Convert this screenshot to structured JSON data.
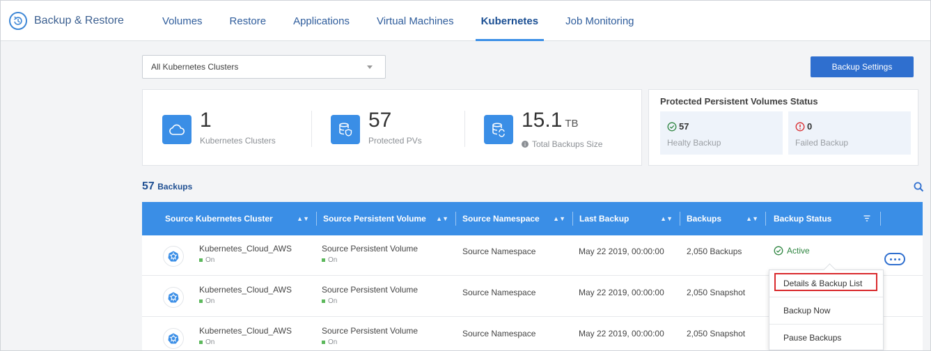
{
  "app": {
    "title": "Backup & Restore"
  },
  "nav": {
    "tabs": [
      {
        "label": "Volumes"
      },
      {
        "label": "Restore"
      },
      {
        "label": "Applications"
      },
      {
        "label": "Virtual Machines"
      },
      {
        "label": "Kubernetes",
        "active": true
      },
      {
        "label": "Job Monitoring"
      }
    ]
  },
  "filter": {
    "selected": "All Kubernetes Clusters"
  },
  "toolbar": {
    "backup_settings_label": "Backup Settings"
  },
  "stats": [
    {
      "value": "1",
      "unit": "",
      "label": "Kubernetes Clusters",
      "icon": "cloud-icon"
    },
    {
      "value": "57",
      "unit": "",
      "label": "Protected PVs",
      "icon": "database-shield-icon"
    },
    {
      "value": "15.1",
      "unit": "TB",
      "label": "Total Backups Size",
      "icon": "database-sync-icon"
    }
  ],
  "pv_status": {
    "title": "Protected Persistent Volumes Status",
    "healthy": {
      "count": "57",
      "label": "Healty Backup"
    },
    "failed": {
      "count": "0",
      "label": "Failed Backup"
    }
  },
  "backups": {
    "count": "57",
    "label": "Backups"
  },
  "table": {
    "columns": [
      "Source Kubernetes Cluster",
      "Source Persistent Volume",
      "Source Namespace",
      "Last Backup",
      "Backups",
      "Backup Status"
    ],
    "rows": [
      {
        "cluster": "Kubernetes_Cloud_AWS",
        "cluster_state": "On",
        "volume": "Source Persistent Volume",
        "volume_state": "On",
        "namespace": "Source Namespace",
        "last_backup": "May 22 2019, 00:00:00",
        "backups": "2,050 Backups",
        "status": "Active"
      },
      {
        "cluster": "Kubernetes_Cloud_AWS",
        "cluster_state": "On",
        "volume": "Source Persistent Volume",
        "volume_state": "On",
        "namespace": "Source Namespace",
        "last_backup": "May 22 2019, 00:00:00",
        "backups": "2,050 Snapshot",
        "status": ""
      },
      {
        "cluster": "Kubernetes_Cloud_AWS",
        "cluster_state": "On",
        "volume": "Source Persistent Volume",
        "volume_state": "On",
        "namespace": "Source Namespace",
        "last_backup": "May 22 2019, 00:00:00",
        "backups": "2,050 Snapshot",
        "status": ""
      }
    ]
  },
  "row_menu": {
    "items": [
      {
        "label": "Details & Backup List"
      },
      {
        "label": "Backup Now"
      },
      {
        "label": "Pause Backups"
      }
    ]
  },
  "colors": {
    "accent": "#3a8ee6",
    "primary_button": "#2f6fcf",
    "success": "#2e8540",
    "error": "#d9292c"
  }
}
